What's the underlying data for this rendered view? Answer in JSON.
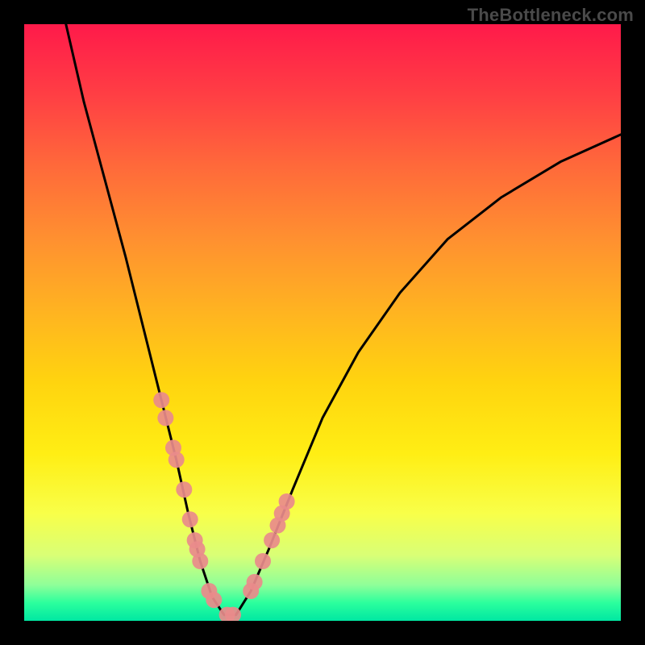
{
  "watermark": "TheBottleneck.com",
  "chart_data": {
    "type": "line",
    "title": "",
    "xlabel": "",
    "ylabel": "",
    "xlim": [
      0,
      100
    ],
    "ylim": [
      0,
      100
    ],
    "grid": false,
    "legend": false,
    "note": "Axes are unlabeled in the image; x/y are in 0-100 plot-area percent. Higher y = nearer top (more red). The curve bottoms out (y≈0) around x≈30-35.",
    "series": [
      {
        "name": "bottleneck-curve",
        "color": "#000000",
        "x": [
          7.0,
          10.0,
          13.5,
          17.0,
          20.0,
          23.0,
          25.5,
          27.5,
          29.5,
          31.5,
          33.5,
          35.5,
          38.0,
          41.0,
          45.0,
          50.0,
          56.0,
          63.0,
          71.0,
          80.0,
          90.0,
          100.0
        ],
        "y": [
          100.0,
          87.0,
          74.0,
          61.0,
          49.0,
          37.0,
          27.0,
          18.0,
          10.0,
          4.0,
          1.0,
          1.0,
          5.0,
          12.0,
          22.0,
          34.0,
          45.0,
          55.0,
          64.0,
          71.0,
          77.0,
          81.5
        ]
      }
    ],
    "markers": {
      "name": "highlight-dots",
      "color": "#e98b8b",
      "radius_px": 10,
      "x": [
        23.0,
        23.7,
        25.0,
        25.5,
        26.8,
        27.8,
        28.6,
        29.0,
        29.5,
        31.0,
        31.8,
        34.0,
        35.0,
        38.0,
        38.6,
        40.0,
        41.5,
        42.5,
        43.2,
        44.0
      ],
      "y": [
        37.0,
        34.0,
        29.0,
        27.0,
        22.0,
        17.0,
        13.5,
        12.0,
        10.0,
        5.0,
        3.5,
        1.0,
        1.0,
        5.0,
        6.5,
        10.0,
        13.5,
        16.0,
        18.0,
        20.0
      ]
    }
  }
}
